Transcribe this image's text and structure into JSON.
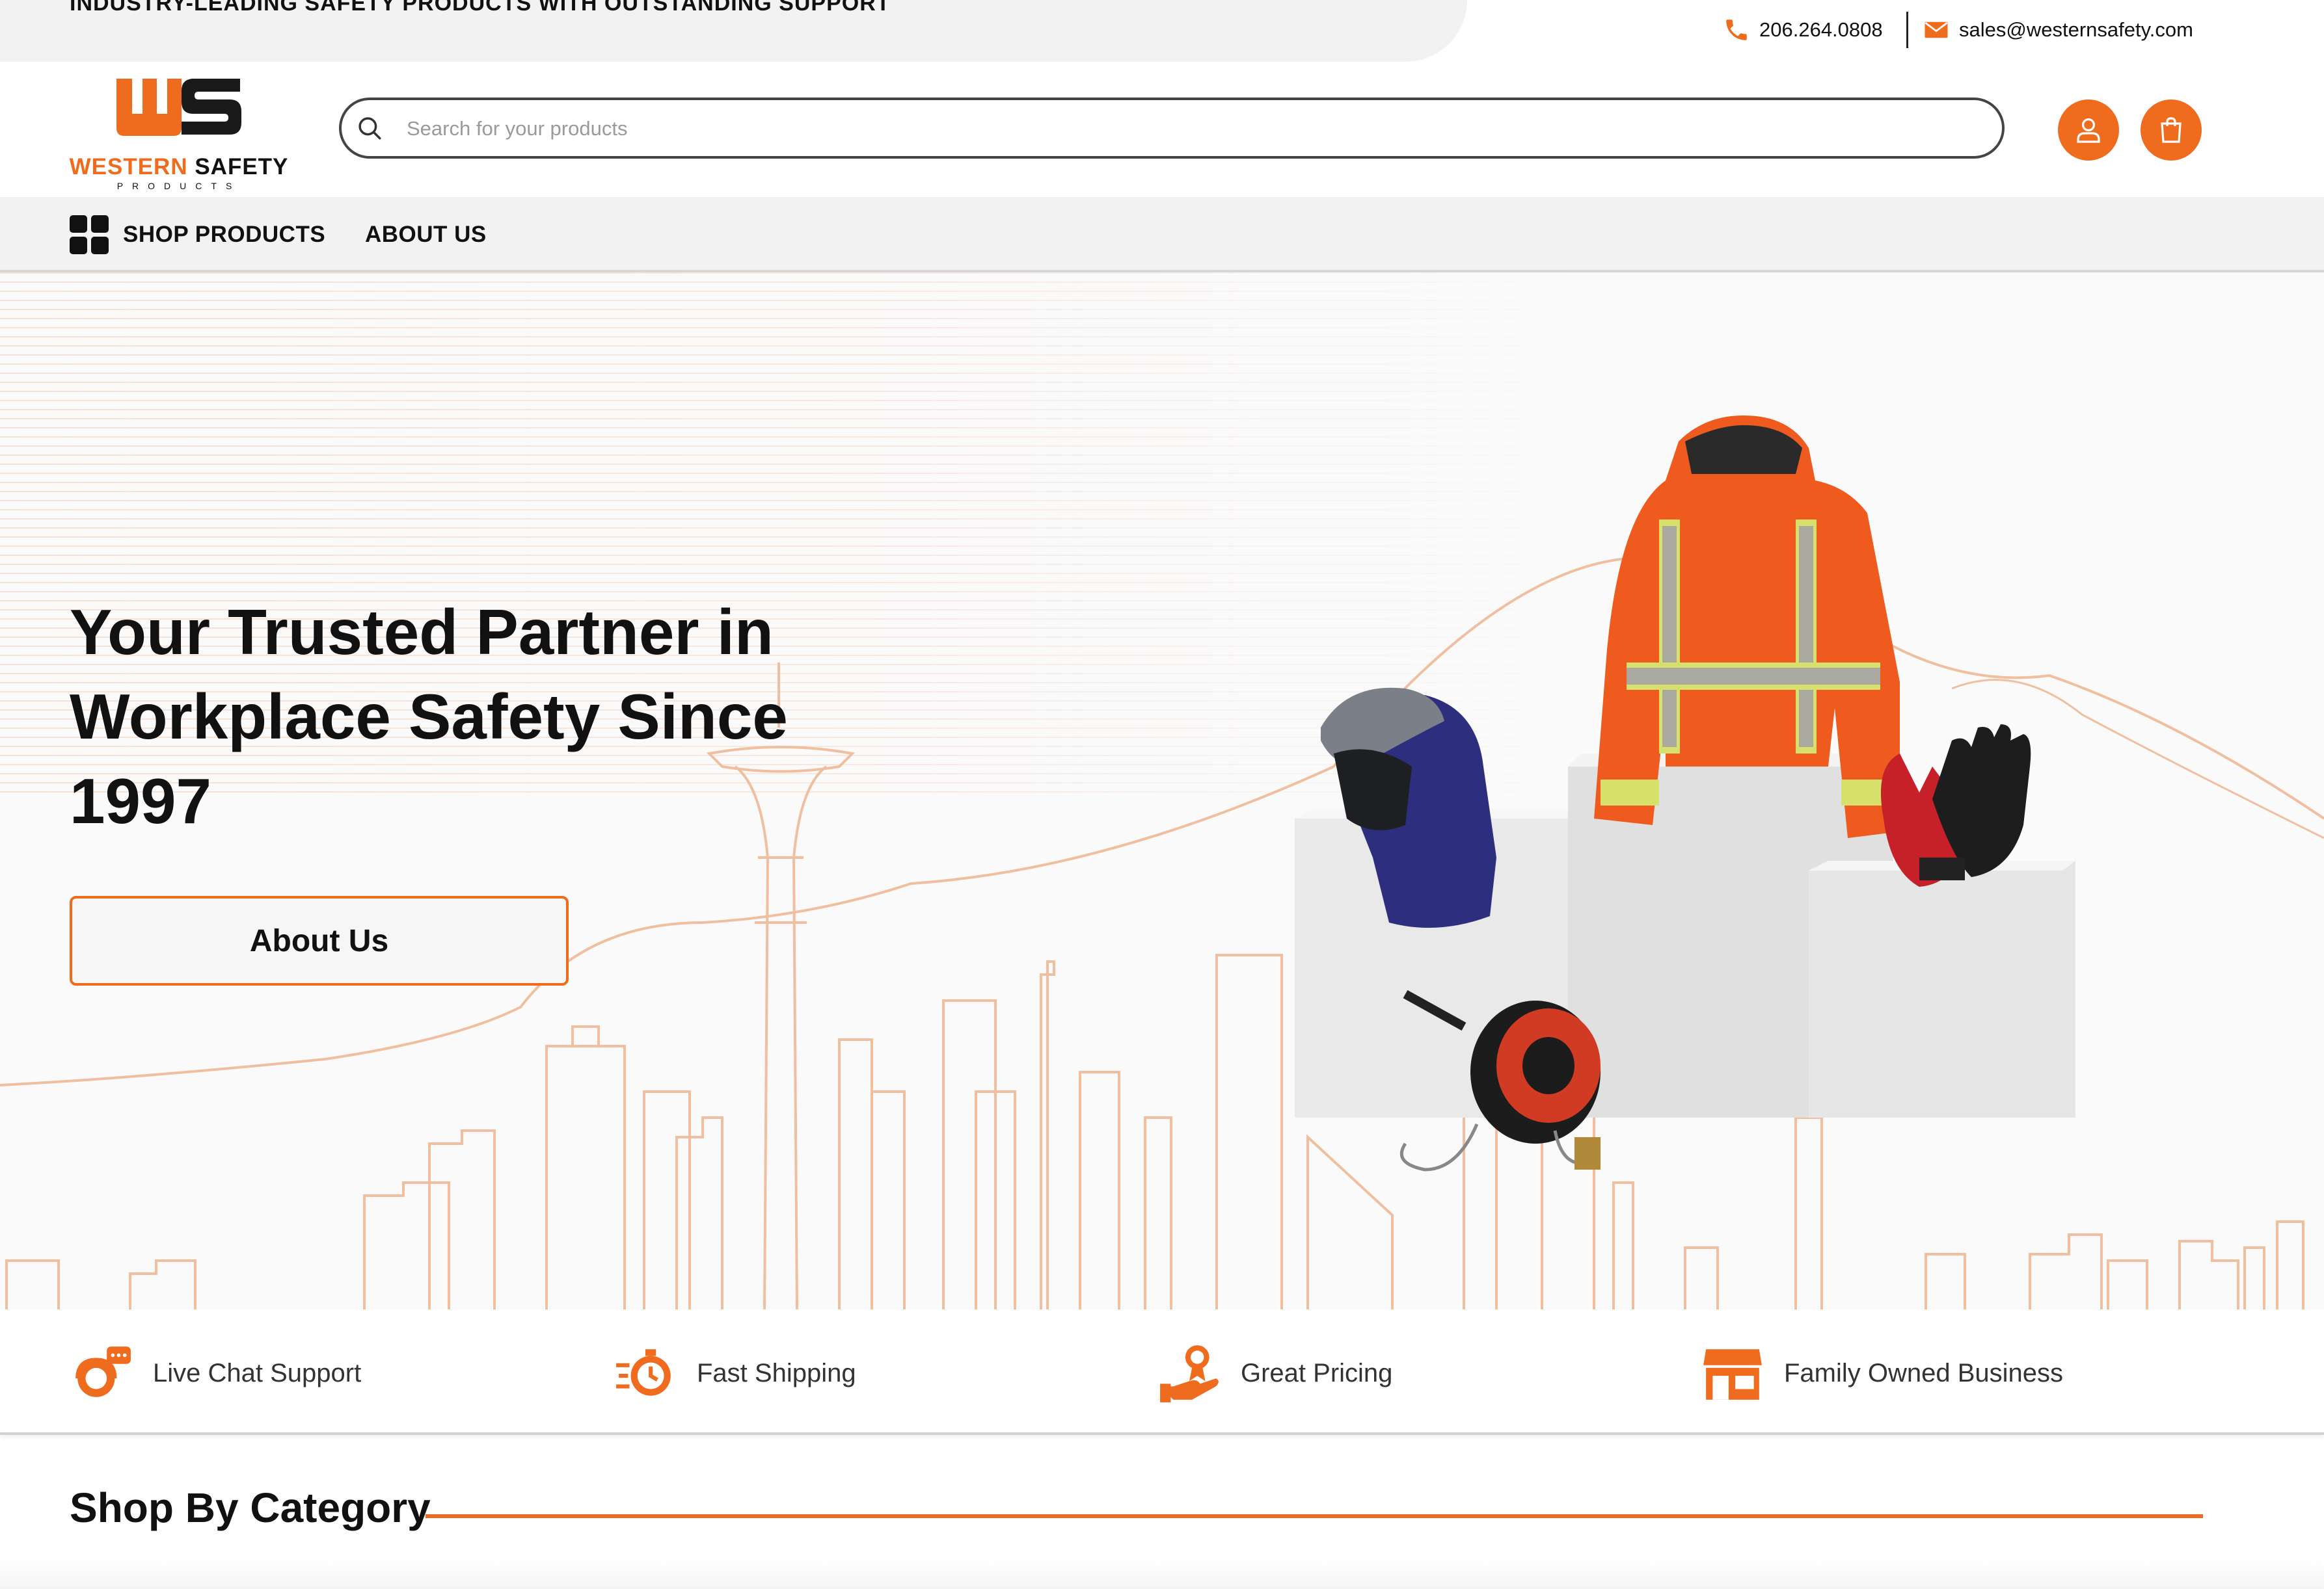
{
  "colors": {
    "accent": "#ef6c1e",
    "text": "#111111",
    "muted_bg": "#f2f2f2"
  },
  "topbar": {
    "tagline": "INDUSTRY-LEADING SAFETY PRODUCTS WITH OUTSTANDING SUPPORT",
    "phone": {
      "icon": "phone-icon",
      "label": "206.264.0808"
    },
    "email": {
      "icon": "envelope-icon",
      "label": "sales@westernsafety.com"
    }
  },
  "header": {
    "logo": {
      "name": "WESTERN",
      "name2": "SAFETY",
      "sub": "PRODUCTS",
      "mark": "WS"
    },
    "search": {
      "placeholder": "Search for your products",
      "value": "",
      "icon": "search-icon"
    },
    "account_icon": "user-icon",
    "cart_icon": "shopping-bag-icon"
  },
  "nav": {
    "items": [
      {
        "label": "SHOP PRODUCTS",
        "icon": "grid-icon"
      },
      {
        "label": "ABOUT US"
      }
    ]
  },
  "hero": {
    "title": "Your Trusted Partner in Workplace Safety Since 1997",
    "button_label": "About Us"
  },
  "features": [
    {
      "label": "Live Chat Support",
      "icon": "chat-support-icon"
    },
    {
      "label": "Fast Shipping",
      "icon": "fast-shipping-icon"
    },
    {
      "label": "Great Pricing",
      "icon": "pricing-hand-icon"
    },
    {
      "label": "Family Owned Business",
      "icon": "storefront-icon"
    }
  ],
  "category": {
    "title": "Shop By Category"
  }
}
